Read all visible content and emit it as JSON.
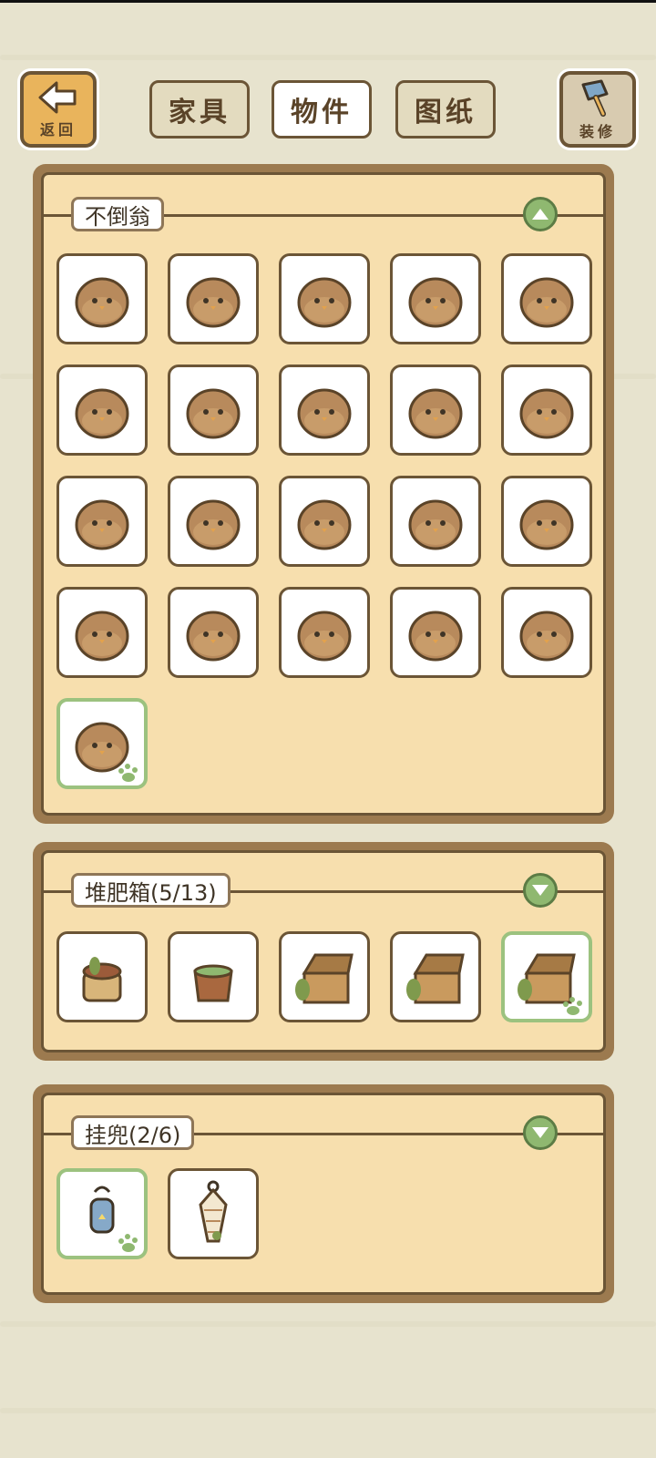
{
  "header": {
    "back_label": "返回",
    "decorate_label": "装修",
    "tabs": [
      {
        "label": "家具",
        "active": false
      },
      {
        "label": "物件",
        "active": true
      },
      {
        "label": "图纸",
        "active": false
      }
    ]
  },
  "sections": [
    {
      "title": "不倒翁",
      "expanded": true,
      "items": [
        {
          "icon": "tumbler-toy-icon",
          "selected": false
        },
        {
          "icon": "tumbler-toy-icon",
          "selected": false
        },
        {
          "icon": "tumbler-toy-icon",
          "selected": false
        },
        {
          "icon": "tumbler-toy-icon",
          "selected": false
        },
        {
          "icon": "tumbler-toy-icon",
          "selected": false
        },
        {
          "icon": "tumbler-toy-icon",
          "selected": false
        },
        {
          "icon": "tumbler-toy-icon",
          "selected": false
        },
        {
          "icon": "tumbler-toy-icon",
          "selected": false
        },
        {
          "icon": "tumbler-toy-icon",
          "selected": false
        },
        {
          "icon": "tumbler-toy-icon",
          "selected": false
        },
        {
          "icon": "tumbler-toy-icon",
          "selected": false
        },
        {
          "icon": "tumbler-toy-icon",
          "selected": false
        },
        {
          "icon": "tumbler-toy-icon",
          "selected": false
        },
        {
          "icon": "tumbler-toy-icon",
          "selected": false
        },
        {
          "icon": "tumbler-toy-icon",
          "selected": false
        },
        {
          "icon": "tumbler-toy-icon",
          "selected": false
        },
        {
          "icon": "tumbler-toy-icon",
          "selected": false
        },
        {
          "icon": "tumbler-toy-icon",
          "selected": false
        },
        {
          "icon": "tumbler-toy-icon",
          "selected": false
        },
        {
          "icon": "tumbler-toy-icon",
          "selected": false
        },
        {
          "icon": "tumbler-toy-icon",
          "selected": true
        }
      ]
    },
    {
      "title": "堆肥箱(5/13)",
      "expanded": false,
      "items": [
        {
          "icon": "compost-bucket-icon",
          "selected": false
        },
        {
          "icon": "compost-tub-icon",
          "selected": false
        },
        {
          "icon": "compost-crate-icon",
          "selected": false
        },
        {
          "icon": "compost-crate-icon",
          "selected": false
        },
        {
          "icon": "compost-crate-icon",
          "selected": true
        }
      ]
    },
    {
      "title": "挂兜(2/6)",
      "expanded": false,
      "items": [
        {
          "icon": "hanging-lantern-icon",
          "selected": true
        },
        {
          "icon": "hanging-net-bag-icon",
          "selected": false
        }
      ]
    }
  ],
  "colors": {
    "background": "#e7e3ce",
    "panel_border": "#9c7a4f",
    "panel_fill": "#f7dfae",
    "accent_green": "#8fb870",
    "selected_border": "#9cc27f"
  }
}
